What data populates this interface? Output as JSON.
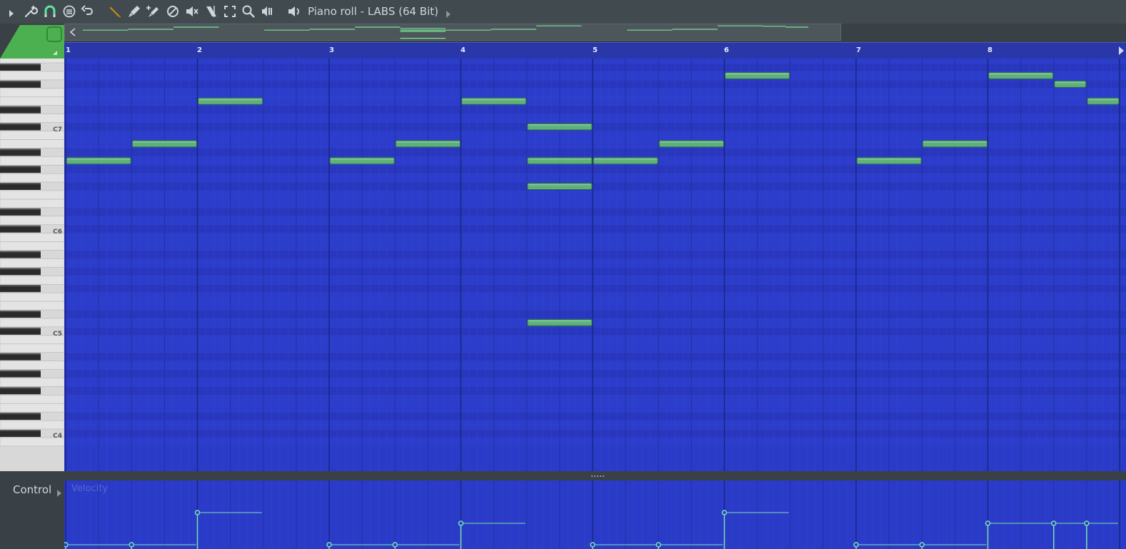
{
  "window": {
    "title": "Piano roll - LABS (64 Bit)"
  },
  "toolbar": {
    "icons": [
      "menu-arrow-icon",
      "wrench-icon",
      "magnet-icon",
      "stamp-icon",
      "undo-icon",
      "pencil-icon",
      "paint-brush-icon",
      "paint-brush-plus-icon",
      "delete-icon",
      "mute-icon",
      "slice-icon",
      "select-icon",
      "zoom-icon",
      "playback-icon",
      "speaker-icon"
    ]
  },
  "ruler": {
    "bars": [
      "1",
      "2",
      "3",
      "4",
      "5",
      "6",
      "7",
      "8"
    ]
  },
  "keyboard": {
    "labels": [
      "C7",
      "C6",
      "C5",
      "C4"
    ]
  },
  "control": {
    "label": "Control",
    "parameter": "Velocity"
  },
  "colors": {
    "grid_bg": "#2a3bc8",
    "note": "#5fb07a",
    "note_border": "#2f6b45",
    "accent": "#4caf50",
    "ruler": "#2a37a8"
  },
  "notes": [
    {
      "pitch": "A6",
      "start": 0,
      "length": 0.5
    },
    {
      "pitch": "B6",
      "start": 0.5,
      "length": 0.5
    },
    {
      "pitch": "E7",
      "start": 1,
      "length": 0.5
    },
    {
      "pitch": "A6",
      "start": 2,
      "length": 0.5
    },
    {
      "pitch": "B6",
      "start": 2.5,
      "length": 0.5
    },
    {
      "pitch": "E7",
      "start": 3,
      "length": 0.5
    },
    {
      "pitch": "C#7",
      "start": 3.5,
      "length": 0.5
    },
    {
      "pitch": "A6",
      "start": 3.5,
      "length": 0.5
    },
    {
      "pitch": "F#6",
      "start": 3.5,
      "length": 0.5
    },
    {
      "pitch": "D5",
      "start": 3.5,
      "length": 0.5
    },
    {
      "pitch": "A6",
      "start": 4,
      "length": 0.5
    },
    {
      "pitch": "B6",
      "start": 4.5,
      "length": 0.5
    },
    {
      "pitch": "G7",
      "start": 5,
      "length": 0.5
    },
    {
      "pitch": "A6",
      "start": 6,
      "length": 0.5
    },
    {
      "pitch": "B6",
      "start": 6.5,
      "length": 0.5
    },
    {
      "pitch": "G7",
      "start": 7,
      "length": 0.5
    },
    {
      "pitch": "F#7",
      "start": 7.5,
      "length": 0.25
    },
    {
      "pitch": "E7",
      "start": 7.75,
      "length": 0.25
    }
  ],
  "velocities": [
    {
      "start": 0,
      "length": 0.5,
      "level": 0.0
    },
    {
      "start": 0.5,
      "length": 0.5,
      "level": 0.0
    },
    {
      "start": 1,
      "length": 0.5,
      "level": 0.9
    },
    {
      "start": 2,
      "length": 0.5,
      "level": 0.0
    },
    {
      "start": 2.5,
      "length": 0.5,
      "level": 0.0
    },
    {
      "start": 3,
      "length": 0.5,
      "level": 0.6
    },
    {
      "start": 4,
      "length": 0.5,
      "level": 0.0
    },
    {
      "start": 4.5,
      "length": 0.5,
      "level": 0.0
    },
    {
      "start": 5,
      "length": 0.5,
      "level": 0.9
    },
    {
      "start": 6,
      "length": 0.5,
      "level": 0.0
    },
    {
      "start": 6.5,
      "length": 0.5,
      "level": 0.0
    },
    {
      "start": 7,
      "length": 0.5,
      "level": 0.6
    },
    {
      "start": 7.5,
      "length": 0.25,
      "level": 0.6
    },
    {
      "start": 7.75,
      "length": 0.25,
      "level": 0.6
    }
  ]
}
